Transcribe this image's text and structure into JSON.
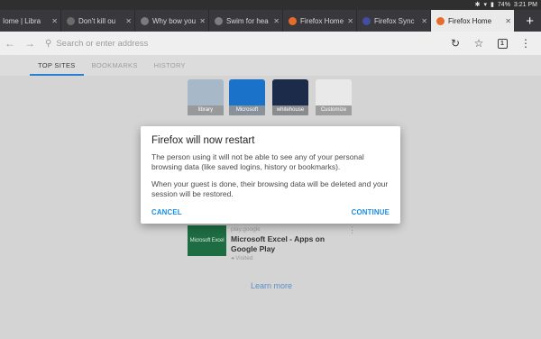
{
  "status_bar": {
    "battery": "74%",
    "time": "3:21 PM"
  },
  "tabs": [
    {
      "label": "Iome | Libra",
      "favicon_color": "#8a8a8a"
    },
    {
      "label": "Don't kill ou",
      "favicon_color": "#6b6b6b"
    },
    {
      "label": "Why bow you",
      "favicon_color": "#7b7b7b"
    },
    {
      "label": "Swim for hea",
      "favicon_color": "#7d7d7d"
    },
    {
      "label": "Firefox Home",
      "favicon_color": "#e66b2d"
    },
    {
      "label": "Firefox Sync",
      "favicon_color": "#444d9e"
    },
    {
      "label": "Firefox Home",
      "favicon_color": "#e66b2d",
      "active": true
    }
  ],
  "toolbar": {
    "url_placeholder": "Search or enter address",
    "tab_count": "1"
  },
  "panel_tabs": [
    {
      "label": "TOP SITES",
      "active": true
    },
    {
      "label": "BOOKMARKS"
    },
    {
      "label": "HISTORY"
    }
  ],
  "top_sites": [
    {
      "label": "library",
      "color": "#a7b8c8"
    },
    {
      "label": "Microsoft",
      "color": "#1a73c9"
    },
    {
      "label": "whitehouse",
      "color": "#1c2b49"
    },
    {
      "label": "Customize",
      "color": "#e9e9e9"
    }
  ],
  "highlight_card": {
    "thumb_text": "Microsoft Excel",
    "source": "play.google",
    "title": "Microsoft Excel - Apps on Google Play",
    "meta": "Visited"
  },
  "learn_more": "Learn more",
  "dialog": {
    "title": "Firefox will now restart",
    "paragraph1": "The person using it will not be able to see any of your personal browsing data (like saved logins, history or bookmarks).",
    "paragraph2": "When your guest is done, their browsing data will be deleted and your session will be restored.",
    "cancel_label": "CANCEL",
    "continue_label": "CONTINUE"
  },
  "colors": {
    "accent": "#1a8ce3",
    "tab_strip": "#38383d",
    "excel_green": "#1e6c41"
  }
}
